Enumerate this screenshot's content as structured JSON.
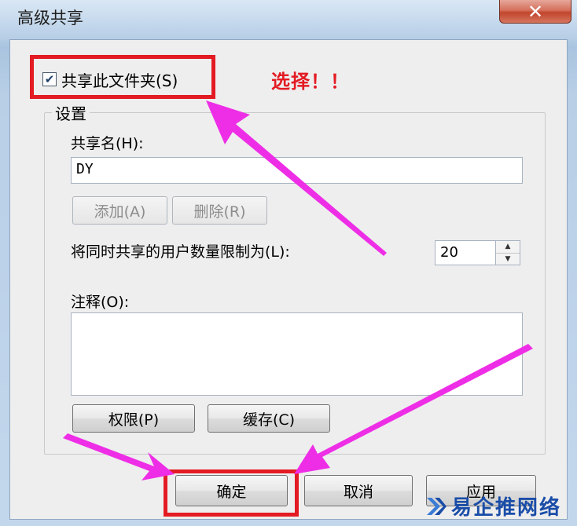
{
  "window": {
    "title": "高级共享",
    "close_label": "✕"
  },
  "share_checkbox": {
    "label": "共享此文件夹(S)",
    "checked": true
  },
  "annotation": {
    "text": "选择！！",
    "color": "#e31b23"
  },
  "settings": {
    "group_title": "设置",
    "share_name_label": "共享名(H):",
    "share_name_value": "DY",
    "add_button": "添加(A)",
    "remove_button": "删除(R)",
    "limit_label": "将同时共享的用户数量限制为(L):",
    "limit_value": "20",
    "comment_label": "注释(O):",
    "comment_value": "",
    "permissions_button": "权限(P)",
    "caching_button": "缓存(C)"
  },
  "footer": {
    "ok_button": "确定",
    "cancel_button": "取消",
    "apply_button": "应用"
  },
  "watermark": {
    "text": "易企推网络"
  },
  "colors": {
    "highlight": "#e31b23",
    "arrow": "#ee2ee6",
    "watermark": "#1a4da8"
  }
}
